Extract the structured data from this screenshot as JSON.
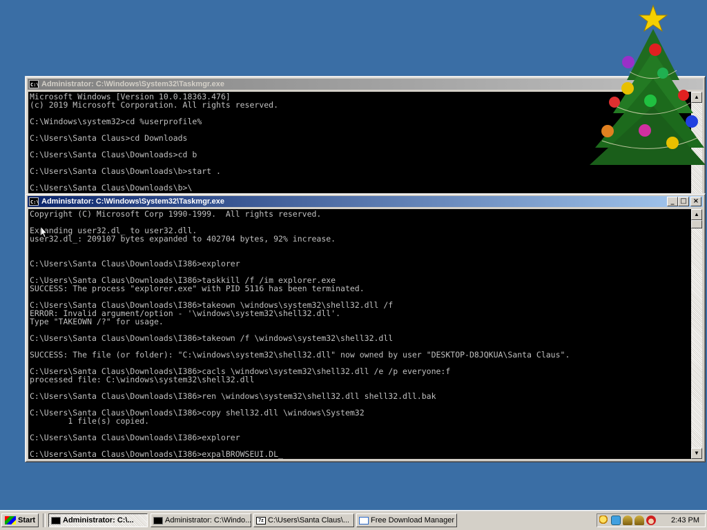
{
  "windows": {
    "back": {
      "title": "Administrator: C:\\Windows\\System32\\Taskmgr.exe",
      "console_text": "Microsoft Windows [Version 10.0.18363.476]\n(c) 2019 Microsoft Corporation. All rights reserved.\n\nC:\\Windows\\system32>cd %userprofile%\n\nC:\\Users\\Santa Claus>cd Downloads\n\nC:\\Users\\Santa Claus\\Downloads>cd b\n\nC:\\Users\\Santa Claus\\Downloads\\b>start .\n\nC:\\Users\\Santa Claus\\Downloads\\b>\\"
    },
    "front": {
      "title": "Administrator: C:\\Windows\\System32\\Taskmgr.exe",
      "console_text": "Copyright (C) Microsoft Corp 1990-1999.  All rights reserved.\n\nExpanding user32.dl_ to user32.dll.\nuser32.dl_: 209107 bytes expanded to 402704 bytes, 92% increase.\n\n\nC:\\Users\\Santa Claus\\Downloads\\I386>explorer\n\nC:\\Users\\Santa Claus\\Downloads\\I386>taskkill /f /im explorer.exe\nSUCCESS: The process \"explorer.exe\" with PID 5116 has been terminated.\n\nC:\\Users\\Santa Claus\\Downloads\\I386>takeown \\windows\\system32\\shell32.dll /f\nERROR: Invalid argument/option - '\\windows\\system32\\shell32.dll'.\nType \"TAKEOWN /?\" for usage.\n\nC:\\Users\\Santa Claus\\Downloads\\I386>takeown /f \\windows\\system32\\shell32.dll\n\nSUCCESS: The file (or folder): \"C:\\windows\\system32\\shell32.dll\" now owned by user \"DESKTOP-D8JQKUA\\Santa Claus\".\n\nC:\\Users\\Santa Claus\\Downloads\\I386>cacls \\windows\\system32\\shell32.dll /e /p everyone:f\nprocessed file: C:\\windows\\system32\\shell32.dll\n\nC:\\Users\\Santa Claus\\Downloads\\I386>ren \\windows\\system32\\shell32.dll shell32.dll.bak\n\nC:\\Users\\Santa Claus\\Downloads\\I386>copy shell32.dll \\windows\\System32\n        1 file(s) copied.\n\nC:\\Users\\Santa Claus\\Downloads\\I386>explorer\n\nC:\\Users\\Santa Claus\\Downloads\\I386>expalBROWSEUI.DL_"
    }
  },
  "taskbar": {
    "start_label": "Start",
    "tasks": [
      {
        "label": "Administrator: C:\\..."
      },
      {
        "label": "Administrator: C:\\Windo..."
      },
      {
        "label": "C:\\Users\\Santa Claus\\..."
      },
      {
        "label": "Free Download Manager"
      }
    ],
    "clock": "2:43 PM"
  },
  "colors": {
    "desktop": "#3a6ea5",
    "active_title": "#0a246a",
    "inactive_title": "#808080"
  },
  "icons": {
    "tray": [
      "search-icon",
      "network-icon",
      "bell-icon",
      "bell-icon",
      "santa-icon"
    ],
    "decoration": "christmas-tree-icon"
  }
}
